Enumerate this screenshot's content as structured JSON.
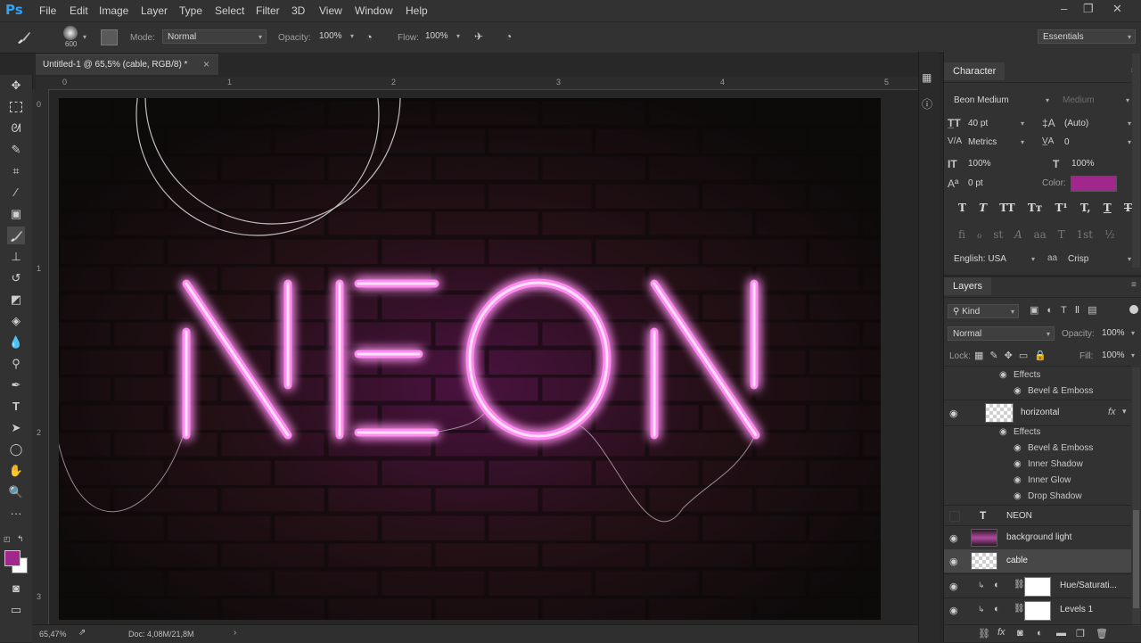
{
  "app": {
    "logo": "Ps"
  },
  "menu": [
    "File",
    "Edit",
    "Image",
    "Layer",
    "Type",
    "Select",
    "Filter",
    "3D",
    "View",
    "Window",
    "Help"
  ],
  "window_controls": {
    "minimize": "‒",
    "restore": "❐",
    "close": "✕"
  },
  "options": {
    "brush_size": "600",
    "mode_label": "Mode:",
    "mode_value": "Normal",
    "opacity_label": "Opacity:",
    "opacity_value": "100%",
    "flow_label": "Flow:",
    "flow_value": "100%",
    "workspace": "Essentials"
  },
  "document": {
    "tab_title": "Untitled-1 @ 65,5% (cable, RGB/8) *",
    "close": "×",
    "canvas_text": "NEON"
  },
  "rulers": {
    "h": [
      "0",
      "1",
      "2",
      "3",
      "4",
      "5"
    ],
    "v": [
      "0",
      "1",
      "2",
      "3"
    ]
  },
  "status": {
    "zoom": "65,47%",
    "doc": "Doc: 4,08M/21,8M"
  },
  "character": {
    "tab": "Character",
    "font_family": "Beon Medium",
    "font_style": "Medium",
    "font_size": "40 pt",
    "leading": "(Auto)",
    "kerning": "Metrics",
    "tracking": "0",
    "vscale": "100%",
    "hscale": "100%",
    "baseline": "0 pt",
    "color_label": "Color:",
    "color": "#a0288c",
    "language": "English: USA",
    "antialias_symbol": "aa",
    "antialias": "Crisp",
    "style_buttons": [
      "T",
      "T",
      "TT",
      "Tт",
      "T¹",
      "T,",
      "T",
      "T"
    ],
    "opentype_buttons": [
      "fi",
      "ℴ",
      "st",
      "A",
      "aa",
      "T",
      "1st",
      "½"
    ]
  },
  "layers": {
    "tab": "Layers",
    "kind": "Kind",
    "blend": "Normal",
    "opacity_label": "Opacity:",
    "opacity": "100%",
    "lock_label": "Lock:",
    "fill_label": "Fill:",
    "fill": "100%",
    "rows": {
      "effects1": "Effects",
      "bevel1": "Bevel & Emboss",
      "horizontal": "horizontal",
      "effects2": "Effects",
      "bevel2": "Bevel & Emboss",
      "inner_shadow": "Inner Shadow",
      "inner_glow": "Inner Glow",
      "drop_shadow": "Drop Shadow",
      "neon": "NEON",
      "background_light": "background light",
      "cable": "cable",
      "hue": "Hue/Saturati...",
      "levels": "Levels 1"
    },
    "fx_symbol": "fx"
  }
}
